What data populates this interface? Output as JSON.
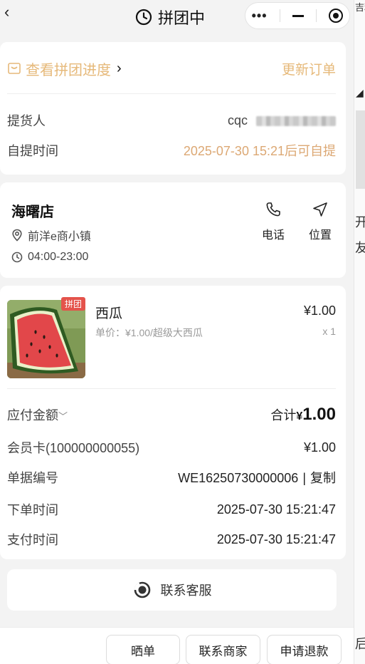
{
  "nav": {
    "back_icon": "chevron-left-icon",
    "title": "拼团中",
    "title_icon": "clock-icon"
  },
  "capsule": {
    "icons": [
      "more-dots-icon",
      "minimize-icon",
      "target-icon"
    ]
  },
  "progress": {
    "link_label": "查看拼团进度",
    "arrow": "›",
    "update_label": "更新订单",
    "accent_color": "#e6b97a"
  },
  "picker": {
    "label": "提货人",
    "name": "cqc"
  },
  "pickup_time": {
    "label": "自提时间",
    "value": "2025-07-30 15:21后可自提",
    "color": "#dca874"
  },
  "store": {
    "name": "海曙店",
    "address": "前洋e商小镇",
    "hours": "04:00-23:00",
    "call_label": "电话",
    "location_label": "位置"
  },
  "product": {
    "tag": "拼团",
    "name": "西瓜",
    "price": "¥1.00",
    "unit_price": "单价：¥1.00/超级大西瓜",
    "quantity": "x 1"
  },
  "summary": {
    "payable_label": "应付金额",
    "payable_chevron": "﹀",
    "total_label": "合计",
    "total_currency": "¥",
    "total_amount": "1.00",
    "member_label": "会员卡(100000000055)",
    "member_value": "¥1.00",
    "order_no_label": "单据编号",
    "order_no_value": "WE16250730000006",
    "copy_sep": "|",
    "copy_label": "复制",
    "order_time_label": "下单时间",
    "order_time_value": "2025-07-30 15:21:47",
    "pay_time_label": "支付时间",
    "pay_time_value": "2025-07-30 15:21:47"
  },
  "service": {
    "label": "联系客服"
  },
  "bottom": {
    "share_label": "晒单",
    "contact_merchant_label": "联系商家",
    "refund_label": "申请退款"
  },
  "edge": {
    "top_text": "吉利",
    "char1": "开",
    "char2": "友",
    "char3": "后"
  }
}
